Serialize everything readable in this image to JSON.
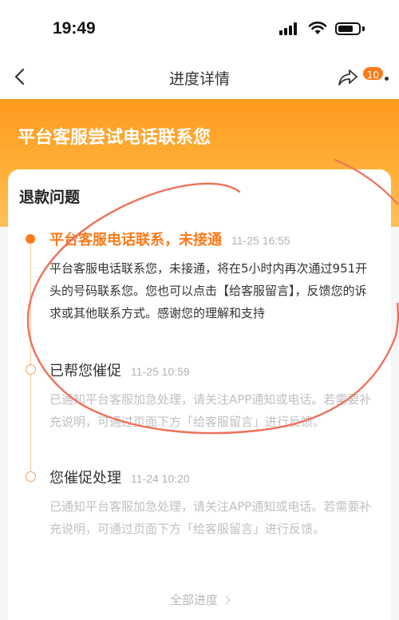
{
  "status_bar": {
    "time": "19:49"
  },
  "nav": {
    "title": "进度详情",
    "badge_count": "10"
  },
  "banner": {
    "title": "平台客服尝试电话联系您"
  },
  "card": {
    "title": "退款问题",
    "steps": [
      {
        "title": "平台客服电话联系，未接通",
        "time": "11-25 16:55",
        "desc": "平台客服电话联系您，未接通，将在5小时内再次通过951开头的号码联系您。您也可以点击【给客服留言】，反馈您的诉求或其他联系方式。感谢您的理解和支持"
      },
      {
        "title": "已帮您催促",
        "time": "11-25 10:59",
        "desc": "已通知平台客服加急处理，请关注APP通知或电话。若需要补充说明，可通过页面下方「给客服留言」进行反馈。"
      },
      {
        "title": "您催促处理",
        "time": "11-24 10:20",
        "desc": "已通知平台客服加急处理，请关注APP通知或电话。若需要补充说明，可通过页面下方「给客服留言」进行反馈。"
      }
    ],
    "all_progress_label": "全部进度"
  },
  "colors": {
    "accent": "#ff7a1a",
    "banner": "#ffa92e",
    "annotation": "#f0705a"
  }
}
